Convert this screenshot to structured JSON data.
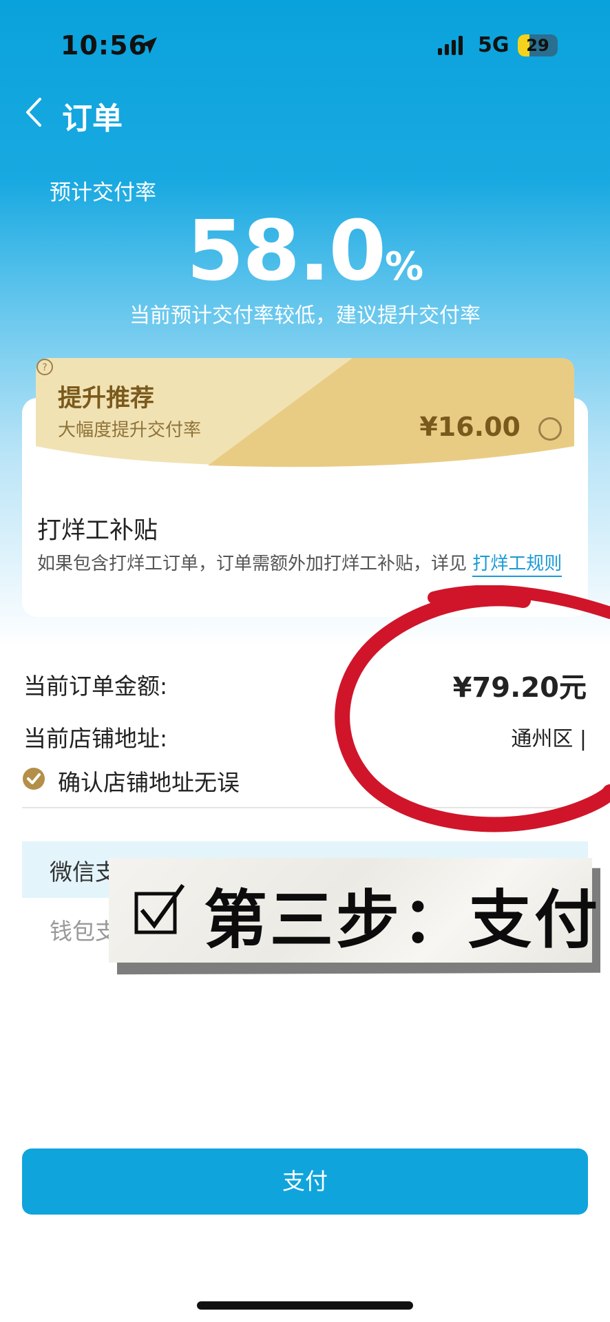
{
  "status_bar": {
    "time": "10:56",
    "network": "5G",
    "battery": "29",
    "battery_level": 0.29,
    "location_icon": "location-arrow-icon",
    "signal_icon": "signal-bars-icon"
  },
  "header": {
    "title": "订单",
    "back_icon": "chevron-left-icon"
  },
  "delivery_rate": {
    "label": "预计交付率",
    "value": "58.0",
    "unit": "%",
    "hint": "当前预计交付率较低，建议提升交付率"
  },
  "promo": {
    "title": "提升推荐",
    "help_icon": "question-circle-icon",
    "subtitle": "大幅度提升交付率",
    "price": "¥16.00",
    "selected": false
  },
  "subsidy": {
    "title": "打烊工补贴",
    "description": "如果包含打烊工订单，订单需额外加打烊工补贴，详见",
    "link": "打烊工规则"
  },
  "order": {
    "amount_label": "当前订单金额:",
    "amount_value": "¥79.20元",
    "address_label": "当前店铺地址:",
    "address_value": "通州区 |",
    "confirm_label": "确认店铺地址无误",
    "confirmed": true
  },
  "payment": {
    "methods": [
      {
        "label": "微信支",
        "selected": true
      },
      {
        "label": "钱包支",
        "selected": false
      }
    ],
    "pay_button": "支付"
  },
  "overlay": {
    "step_text": "第三步：支付",
    "checkbox_icon": "checkbox-checked-icon"
  },
  "colors": {
    "brand_blue": "#10a4dd",
    "gold": "#e9cc84",
    "annotation_red": "#d0152a"
  }
}
